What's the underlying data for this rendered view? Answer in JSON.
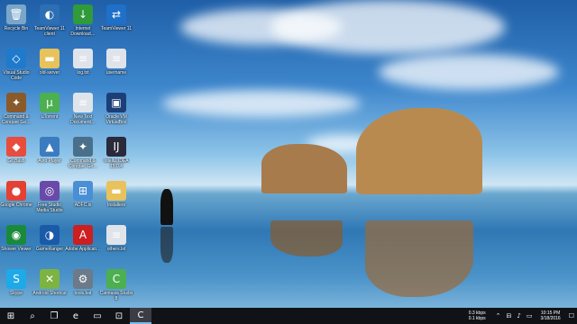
{
  "desktop": {
    "icons": [
      {
        "label": "Recycle Bin",
        "icon": "recycle-bin-icon",
        "color": "#7aa6c9",
        "glyph": "🗑"
      },
      {
        "label": "TeamViewer 11 client",
        "icon": "teamviewer-icon",
        "color": "#2c6fb4",
        "glyph": "◐"
      },
      {
        "label": "Internet Download…",
        "icon": "idm-icon",
        "color": "#2f9b3a",
        "glyph": "↓"
      },
      {
        "label": "TeamViewer 11",
        "icon": "teamviewer-icon",
        "color": "#1e70c8",
        "glyph": "⇄"
      },
      {
        "label": "Visual Studio Code",
        "icon": "vscode-icon",
        "color": "#1f7acc",
        "glyph": "◇"
      },
      {
        "label": "old-server",
        "icon": "folder-icon",
        "color": "#e8c25a",
        "glyph": "▬"
      },
      {
        "label": "log.txt",
        "icon": "text-file-icon",
        "color": "#dfe4ea",
        "glyph": "≡"
      },
      {
        "label": "username",
        "icon": "text-file-icon",
        "color": "#dfe4ea",
        "glyph": "≡"
      },
      {
        "label": "Command & Conquer Ge…",
        "icon": "cnc-generals-icon",
        "color": "#8a5a2a",
        "glyph": "✦"
      },
      {
        "label": "uTorrent",
        "icon": "utorrent-icon",
        "color": "#4caf50",
        "glyph": "µ"
      },
      {
        "label": "New Text Document…",
        "icon": "text-file-icon",
        "color": "#dfe4ea",
        "glyph": "≡"
      },
      {
        "label": "Oracle VM VirtualBox",
        "icon": "virtualbox-icon",
        "color": "#1c3f78",
        "glyph": "▣"
      },
      {
        "label": "Git Bash",
        "icon": "git-bash-icon",
        "color": "#e84c3d",
        "glyph": "◆"
      },
      {
        "label": "Avro Player",
        "icon": "avro-player-icon",
        "color": "#3b7bbf",
        "glyph": "▲"
      },
      {
        "label": "Command & Conquer Ge…",
        "icon": "cnc-generals-icon",
        "color": "#4a6f8a",
        "glyph": "✦"
      },
      {
        "label": "IntelliJ IDEA 15.0.4",
        "icon": "intellij-icon",
        "color": "#2a2a3a",
        "glyph": "IJ"
      },
      {
        "label": "Google Chrome",
        "icon": "chrome-icon",
        "color": "#e34133",
        "glyph": "●"
      },
      {
        "label": "Free Studio Media Studio",
        "icon": "free-studio-icon",
        "color": "#6a4aa8",
        "glyph": "◎"
      },
      {
        "label": "ADFC.ix",
        "icon": "adfc-icon",
        "color": "#4a8fd6",
        "glyph": "⊞"
      },
      {
        "label": "Installers",
        "icon": "folder-icon",
        "color": "#e8c25a",
        "glyph": "▬"
      },
      {
        "label": "Shower Viewer",
        "icon": "shower-viewer-icon",
        "color": "#1a8a3a",
        "glyph": "◉"
      },
      {
        "label": "GameRanger",
        "icon": "gameranger-icon",
        "color": "#1a5aa8",
        "glyph": "◑"
      },
      {
        "label": "Adobe Applicati…",
        "icon": "adobe-icon",
        "color": "#cc1f1f",
        "glyph": "A"
      },
      {
        "label": "others.txt",
        "icon": "text-file-icon",
        "color": "#dfe4ea",
        "glyph": "≡"
      },
      {
        "label": "Skype",
        "icon": "skype-icon",
        "color": "#1ea9e8",
        "glyph": "S"
      },
      {
        "label": "Android Shortcut",
        "icon": "android-icon",
        "color": "#7cb342",
        "glyph": "✕"
      },
      {
        "label": "tools.bat",
        "icon": "batch-file-icon",
        "color": "#6c7a89",
        "glyph": "⚙"
      },
      {
        "label": "Camtasia Studio 8",
        "icon": "camtasia-icon",
        "color": "#4caf50",
        "glyph": "C"
      }
    ]
  },
  "taskbar": {
    "buttons": [
      {
        "name": "start-button",
        "glyph": "⊞"
      },
      {
        "name": "search-button",
        "glyph": "⌕"
      },
      {
        "name": "task-view-button",
        "glyph": "❐"
      },
      {
        "name": "edge-taskbar-button",
        "glyph": "e"
      },
      {
        "name": "file-explorer-taskbar-button",
        "glyph": "▭"
      },
      {
        "name": "store-taskbar-button",
        "glyph": "⊡"
      },
      {
        "name": "camtasia-taskbar-button",
        "glyph": "C"
      }
    ],
    "net_up": "0.3 kbps",
    "net_down": "0.1 kbps",
    "time": "10:15 PM",
    "date": "3/18/2016"
  }
}
